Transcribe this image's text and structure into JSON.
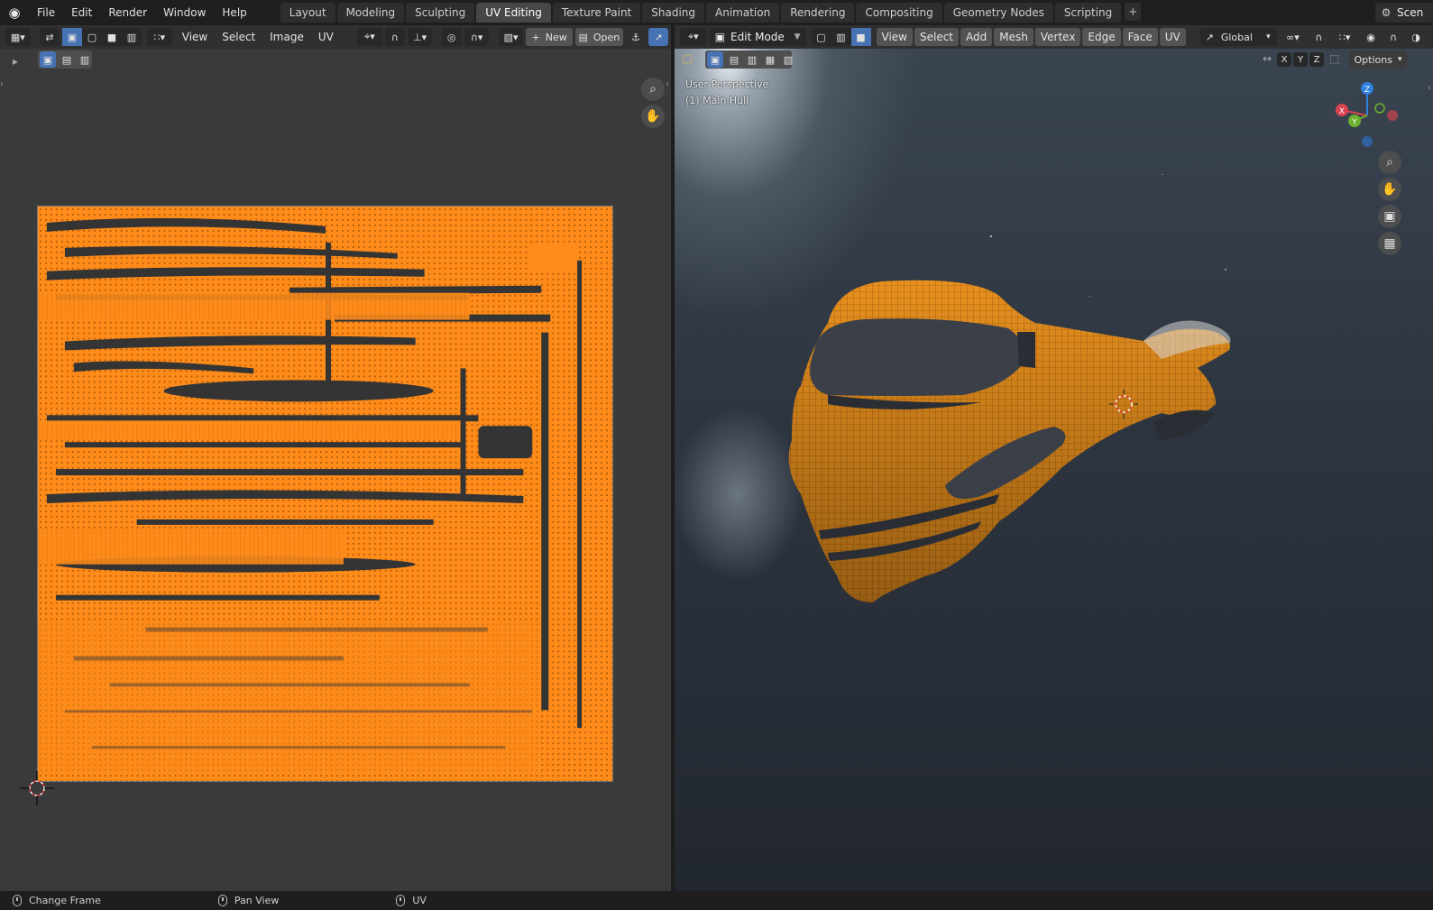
{
  "topbar": {
    "menus": [
      "File",
      "Edit",
      "Render",
      "Window",
      "Help"
    ],
    "workspaces": [
      "Layout",
      "Modeling",
      "Sculpting",
      "UV Editing",
      "Texture Paint",
      "Shading",
      "Animation",
      "Rendering",
      "Compositing",
      "Geometry Nodes",
      "Scripting"
    ],
    "active_workspace": "UV Editing",
    "add_label": "+",
    "scene_label": "Scen"
  },
  "uv_editor": {
    "menus": [
      "View",
      "Select",
      "Image",
      "UV"
    ],
    "new_label": "New",
    "open_label": "Open"
  },
  "viewport": {
    "mode": "Edit Mode",
    "menus": [
      "View",
      "Select",
      "Add",
      "Mesh",
      "Vertex",
      "Edge",
      "Face",
      "UV"
    ],
    "orientation": "Global",
    "axes": [
      "X",
      "Y",
      "Z"
    ],
    "options_label": "Options",
    "view_name": "User Perspective",
    "object_label": "(1) Main Hull",
    "gizmo": {
      "x": "X",
      "y": "Y",
      "z": "Z"
    }
  },
  "statusbar": {
    "items": [
      "Change Frame",
      "Pan View",
      "UV"
    ]
  },
  "colors": {
    "accent": "#4772b3",
    "uv_orange": "#ff8c1a",
    "hull_orange": "#e8901e"
  }
}
